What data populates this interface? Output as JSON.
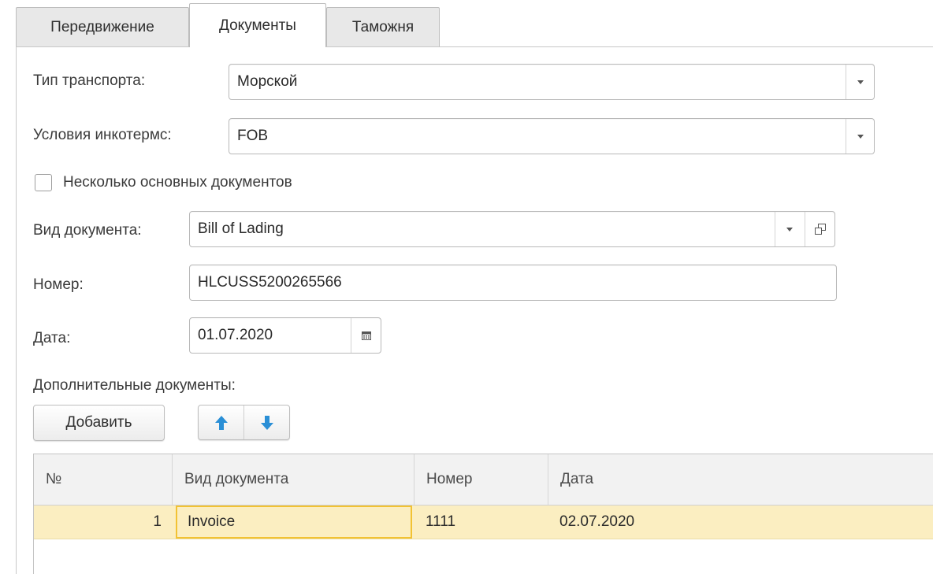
{
  "tabs": [
    {
      "label": "Передвижение",
      "active": false
    },
    {
      "label": "Документы",
      "active": true
    },
    {
      "label": "Таможня",
      "active": false
    }
  ],
  "form": {
    "transport_type": {
      "label": "Тип транспорта:",
      "value": "Морской"
    },
    "incoterms": {
      "label": "Условия инкотермс:",
      "value": "FOB"
    },
    "multiple_docs": {
      "label": "Несколько основных документов",
      "checked": false
    },
    "doc_type": {
      "label": "Вид документа:",
      "value": "Bill of Lading"
    },
    "number": {
      "label": "Номер:",
      "value": "HLCUSS5200265566"
    },
    "date": {
      "label": "Дата:",
      "value": "01.07.2020"
    },
    "additional_docs_label": "Дополнительные документы:"
  },
  "toolbar": {
    "add_label": "Добавить"
  },
  "table": {
    "columns": [
      "№",
      "Вид документа",
      "Номер",
      "Дата"
    ],
    "rows": [
      {
        "n": "1",
        "doc_type": "Invoice",
        "number": "1111",
        "date": "02.07.2020"
      }
    ]
  },
  "colors": {
    "selected_row": "#fbeec1",
    "focus_border": "#f2c233",
    "arrow_up": "#2a8fd6",
    "arrow_down": "#2a8fd6"
  },
  "icons": {
    "dropdown": "chevron-down-icon",
    "open": "open-form-icon",
    "calendar": "calendar-icon",
    "move_up": "arrow-up-icon",
    "move_down": "arrow-down-icon"
  }
}
